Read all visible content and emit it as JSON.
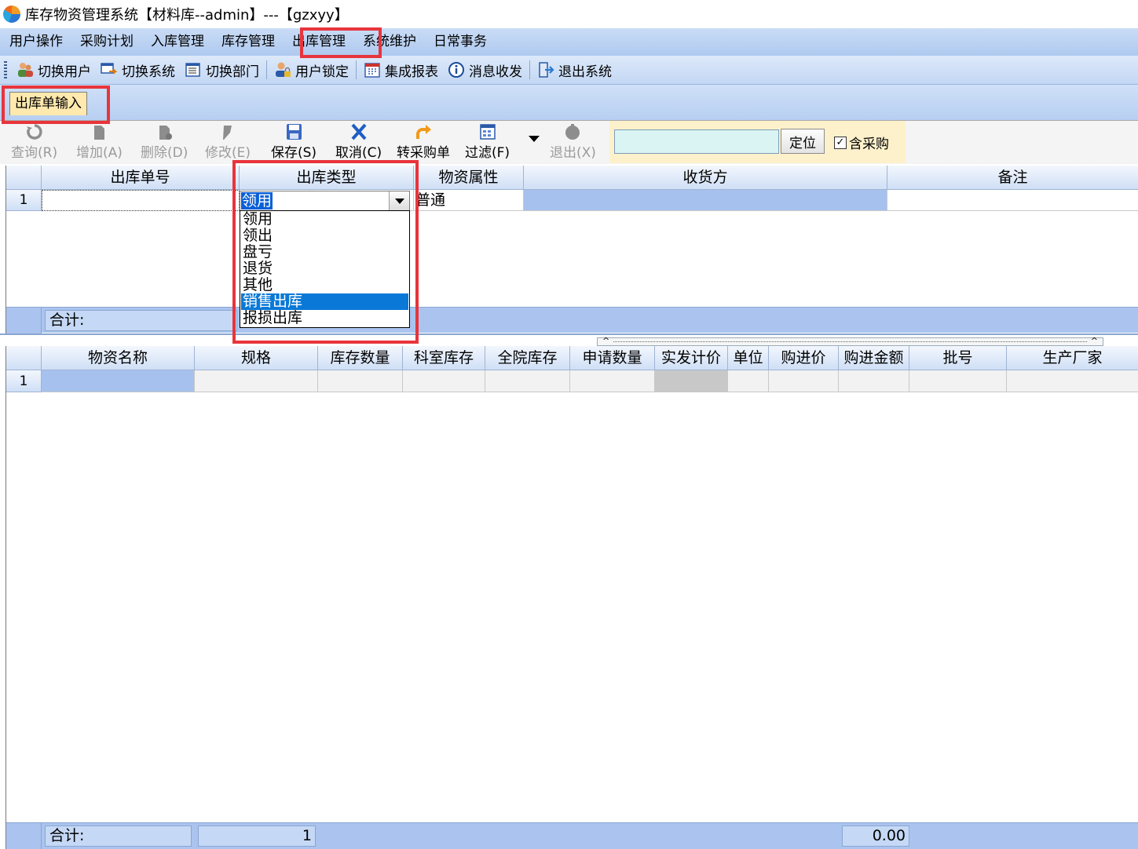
{
  "window": {
    "title": "库存物资管理系统【材料库--admin】---【gzxyy】"
  },
  "menubar": {
    "items": [
      "用户操作",
      "采购计划",
      "入库管理",
      "库存管理",
      "出库管理",
      "系统维护",
      "日常事务"
    ]
  },
  "quickbar": {
    "switch_user": "切换用户",
    "switch_system": "切换系统",
    "switch_dept": "切换部门",
    "lock_user": "用户锁定",
    "integrated_report": "集成报表",
    "messages": "消息收发",
    "exit_system": "退出系统"
  },
  "tabs": {
    "active": "出库单输入"
  },
  "formbar": {
    "query": "查询(R)",
    "add": "增加(A)",
    "delete": "删除(D)",
    "modify": "修改(E)",
    "save": "保存(S)",
    "cancel": "取消(C)",
    "to_purchase": "转采购单",
    "filter": "过滤(F)",
    "exit": "退出(X)",
    "search_value": "",
    "locate": "定位",
    "include_purchase": "含采购",
    "include_purchase_checked": true
  },
  "upper_grid": {
    "columns": [
      "出库单号",
      "出库类型",
      "物资属性",
      "收货方",
      "备注"
    ],
    "rows": [
      {
        "row_no": "1",
        "order_no": "",
        "type": "领用",
        "attribute": "普通",
        "receiver": "",
        "remark": ""
      }
    ],
    "total_label": "合计:"
  },
  "type_dropdown": {
    "selected_value": "领用",
    "options": [
      "领用",
      "领出",
      "盘亏",
      "退货",
      "其他",
      "销售出库",
      "报损出库"
    ],
    "highlighted": "销售出库"
  },
  "lower_grid": {
    "columns": [
      "物资名称",
      "规格",
      "库存数量",
      "科室库存",
      "全院库存",
      "申请数量",
      "实发计价",
      "单位",
      "购进价",
      "购进金额",
      "批号",
      "生产厂家"
    ],
    "rows": [
      {
        "row_no": "1"
      }
    ],
    "total_label": "合计:",
    "total_count": "1",
    "total_amount": "0.00"
  },
  "colors": {
    "highlight": "#e8343c",
    "selection": "#0a78d7",
    "menubar": "#afc9ef"
  }
}
